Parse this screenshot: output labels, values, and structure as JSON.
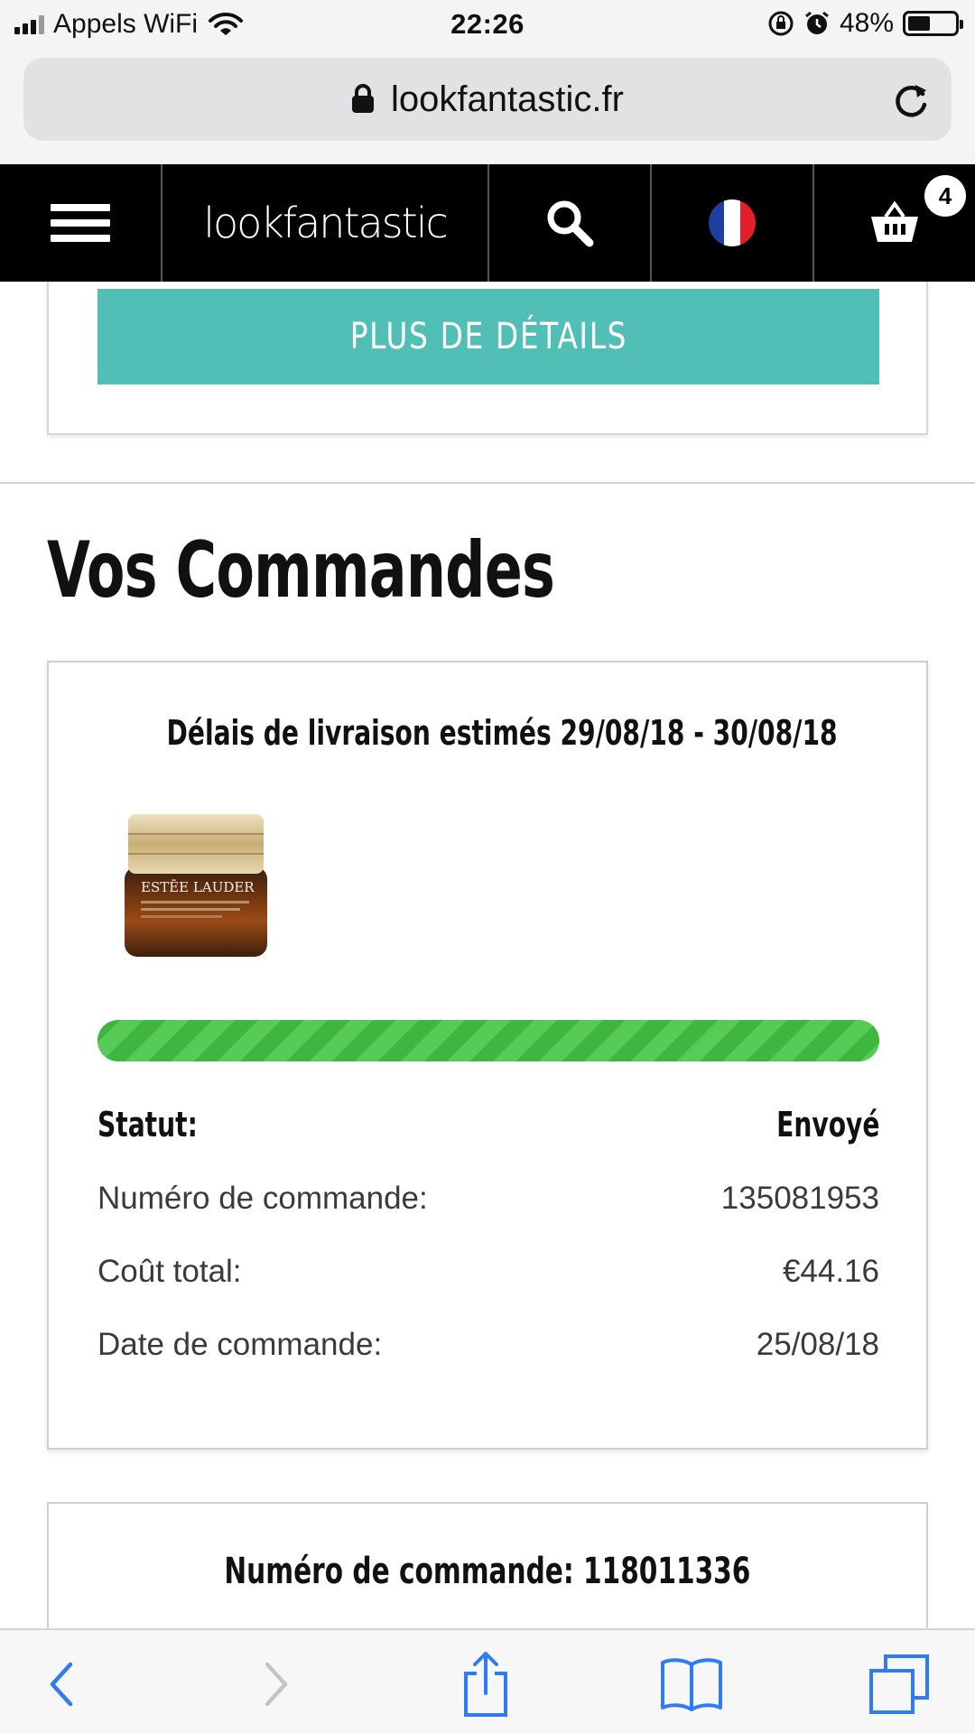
{
  "status_bar": {
    "carrier": "Appels WiFi",
    "time": "22:26",
    "battery": "48%",
    "battery_level": 0.48
  },
  "browser": {
    "url": "lookfantastic.fr"
  },
  "header": {
    "logo": "lookfantastic",
    "cart_count": "4",
    "flag_colors": [
      "#1f3fa0",
      "#ffffff",
      "#e2202c"
    ]
  },
  "top_card": {
    "details_button": "PLUS DE DÉTAILS"
  },
  "page": {
    "title": "Vos Commandes"
  },
  "order": {
    "delivery_estimate": "Délais de livraison estimés 29/08/18 - 30/08/18",
    "product_label": "ESTĒE LAUDER",
    "progress": 1.0,
    "status_label": "Statut:",
    "status_value": "Envoyé",
    "rows": [
      {
        "label": "Numéro de commande:",
        "value": "135081953"
      },
      {
        "label": "Coût total:",
        "value": "€44.16"
      },
      {
        "label": "Date de commande:",
        "value": "25/08/18"
      }
    ]
  },
  "next_order": {
    "title": "Numéro de commande: 118011336"
  },
  "colors": {
    "accent_teal": "#52bfb7",
    "progress_green": "#3bb03b",
    "ios_blue": "#2f7bf5"
  }
}
